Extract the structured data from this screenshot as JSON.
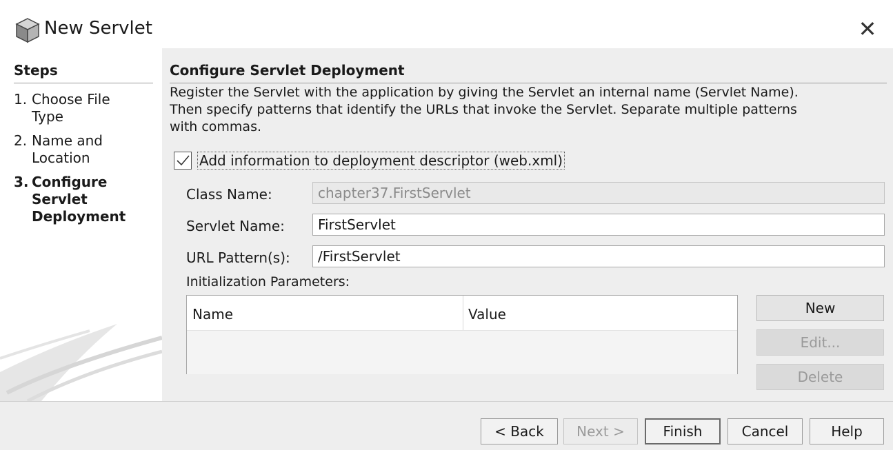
{
  "window": {
    "title": "New Servlet",
    "close_glyph": "✕",
    "icon": "cube-icon"
  },
  "sidebar": {
    "title": "Steps",
    "steps": [
      {
        "num": "1.",
        "label_line1": "Choose File",
        "label_line2": "Type",
        "active": false
      },
      {
        "num": "2.",
        "label_line1": "Name and",
        "label_line2": "Location",
        "active": false
      },
      {
        "num": "3.",
        "label_line1": "Configure",
        "label_line2": "Servlet",
        "label_line3": "Deployment",
        "active": true
      }
    ]
  },
  "main": {
    "title": "Configure Servlet Deployment",
    "description_lines": [
      "Register the Servlet with the application by giving the Servlet an internal name (Servlet Name).",
      "Then specify patterns that identify the URLs that invoke the Servlet. Separate multiple patterns",
      "with commas."
    ],
    "add_info_checkbox": {
      "label": "Add information to deployment descriptor (web.xml)",
      "checked": true
    },
    "class_name": {
      "label": "Class Name:",
      "value": "chapter37.FirstServlet",
      "enabled": false
    },
    "servlet_name": {
      "label": "Servlet Name:",
      "value": "FirstServlet"
    },
    "url_patterns": {
      "label": "URL Pattern(s):",
      "value": "/FirstServlet"
    },
    "init_params": {
      "label": "Initialization Parameters:",
      "columns": [
        "Name",
        "Value"
      ],
      "rows": []
    },
    "side_buttons": {
      "new": "New",
      "edit": "Edit...",
      "delete": "Delete"
    }
  },
  "footer": {
    "back": "< Back",
    "next": "Next >",
    "finish": "Finish",
    "cancel": "Cancel",
    "help": "Help"
  },
  "colors": {
    "content_bg": "#eeeeee",
    "field_bg": "#ffffff",
    "disabled_text": "#9a9a9a"
  }
}
